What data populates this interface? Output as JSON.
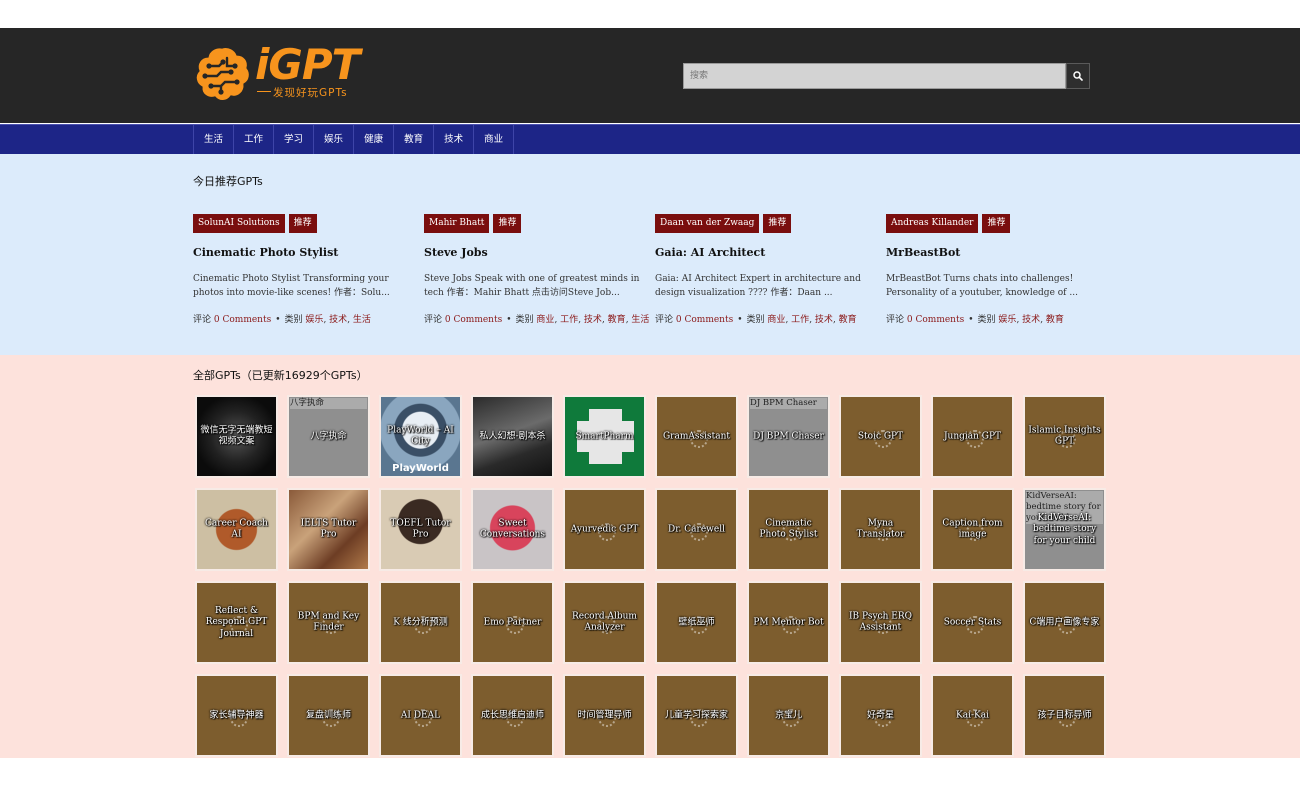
{
  "site": {
    "brand": "iGPT",
    "tagline": "发现好玩GPTs",
    "search_placeholder": "搜索"
  },
  "nav": [
    "生活",
    "工作",
    "学习",
    "娱乐",
    "健康",
    "教育",
    "技术",
    "商业"
  ],
  "featured": {
    "title": "今日推荐GPTs",
    "badge": "推荐",
    "comment_prefix": "评论",
    "category_prefix": "类别",
    "cards": [
      {
        "author": "SolunAI Solutions",
        "title": "Cinematic Photo Stylist",
        "desc": "Cinematic Photo Stylist Transforming your photos into movie-like scenes! 作者：Solu...",
        "comments": "0 Comments",
        "categories": [
          "娱乐",
          "技术",
          "生活"
        ]
      },
      {
        "author": "Mahir Bhatt",
        "title": "Steve Jobs",
        "desc": "Steve Jobs Speak with one of greatest minds in tech 作者：Mahir Bhatt 点击访问Steve Job...",
        "comments": "0 Comments",
        "categories": [
          "商业",
          "工作",
          "技术",
          "教育",
          "生活"
        ]
      },
      {
        "author": "Daan van der Zwaag",
        "title": "Gaia: AI Architect",
        "desc": "Gaia: AI Architect Expert in architecture and design visualization ???? 作者：Daan ...",
        "comments": "0 Comments",
        "categories": [
          "商业",
          "工作",
          "技术",
          "教育"
        ]
      },
      {
        "author": "Andreas Killander",
        "title": "MrBeastBot",
        "desc": "MrBeastBot Turns chats into challenges! Personality of a youtuber, knowledge of ...",
        "comments": "0 Comments",
        "categories": [
          "娱乐",
          "技术",
          "教育"
        ]
      }
    ]
  },
  "all": {
    "title": "全部GPTs（已更新16929个GPTs）",
    "tiles": [
      {
        "label": "微信无字无端教短视频文案",
        "style": "img-dark"
      },
      {
        "label": "八字执命",
        "style": "gray",
        "alt": "八字执命"
      },
      {
        "label": "PlayWorld – AI City",
        "style": "img-blue",
        "caption": "PlayWorld"
      },
      {
        "label": "私人幻想-剧本杀",
        "style": "img-night"
      },
      {
        "label": "SmartPharm",
        "style": "img-green"
      },
      {
        "label": "GramAssistant",
        "style": "brown"
      },
      {
        "label": "DJ BPM Chaser",
        "style": "gray",
        "alt": "DJ BPM Chaser"
      },
      {
        "label": "Stoic GPT",
        "style": "brown"
      },
      {
        "label": "Jungian GPT",
        "style": "brown"
      },
      {
        "label": "Islamic Insights GPT",
        "style": "brown"
      },
      {
        "label": "Career Coach AI",
        "style": "img-beige"
      },
      {
        "label": "IELTS Tutor Pro",
        "style": "img-warm"
      },
      {
        "label": "TOEFL Tutor Pro",
        "style": "img-toefl"
      },
      {
        "label": "Sweet Conversations",
        "style": "img-pink"
      },
      {
        "label": "Ayurvedic GPT",
        "style": "brown"
      },
      {
        "label": "Dr. Carewell",
        "style": "brown"
      },
      {
        "label": "Cinematic Photo Stylist",
        "style": "brown"
      },
      {
        "label": "Myna Translator",
        "style": "brown"
      },
      {
        "label": "Caption from image",
        "style": "brown"
      },
      {
        "label": "KidVerseAI: bedtime story for your child",
        "style": "gray",
        "alt": "KidVerseAI: bedtime story for your child"
      },
      {
        "label": "Reflect & Respond GPT Journal",
        "style": "brown"
      },
      {
        "label": "BPM and Key Finder",
        "style": "brown"
      },
      {
        "label": "K 线分析预测",
        "style": "brown"
      },
      {
        "label": "Emo Partner",
        "style": "brown"
      },
      {
        "label": "Record Album Analyzer",
        "style": "brown"
      },
      {
        "label": "壁纸巫师",
        "style": "brown"
      },
      {
        "label": "PM Mentor Bot",
        "style": "brown"
      },
      {
        "label": "IB Psych ERQ Assistant",
        "style": "brown"
      },
      {
        "label": "Soccer Stats",
        "style": "brown"
      },
      {
        "label": "C端用户画像专家",
        "style": "brown"
      },
      {
        "label": "家长辅导神器",
        "style": "brown"
      },
      {
        "label": "复盘训练师",
        "style": "brown"
      },
      {
        "label": "AI DEAL",
        "style": "brown"
      },
      {
        "label": "成长思维启迪师",
        "style": "brown"
      },
      {
        "label": "时间管理导师",
        "style": "brown"
      },
      {
        "label": "儿童学习探索家",
        "style": "brown"
      },
      {
        "label": "京宝儿",
        "style": "brown"
      },
      {
        "label": "好奇星",
        "style": "brown"
      },
      {
        "label": "Kai-Kai",
        "style": "brown"
      },
      {
        "label": "孩子目标导师",
        "style": "brown"
      }
    ]
  },
  "colors": {
    "header_bg": "#262626",
    "nav_bg": "#1d2587",
    "brand_orange": "#f7941d",
    "featured_bg": "#dcebfb",
    "all_bg": "#fde2dc",
    "tag_red": "#7a0e0e",
    "tile_brown": "#7d5d2e"
  }
}
